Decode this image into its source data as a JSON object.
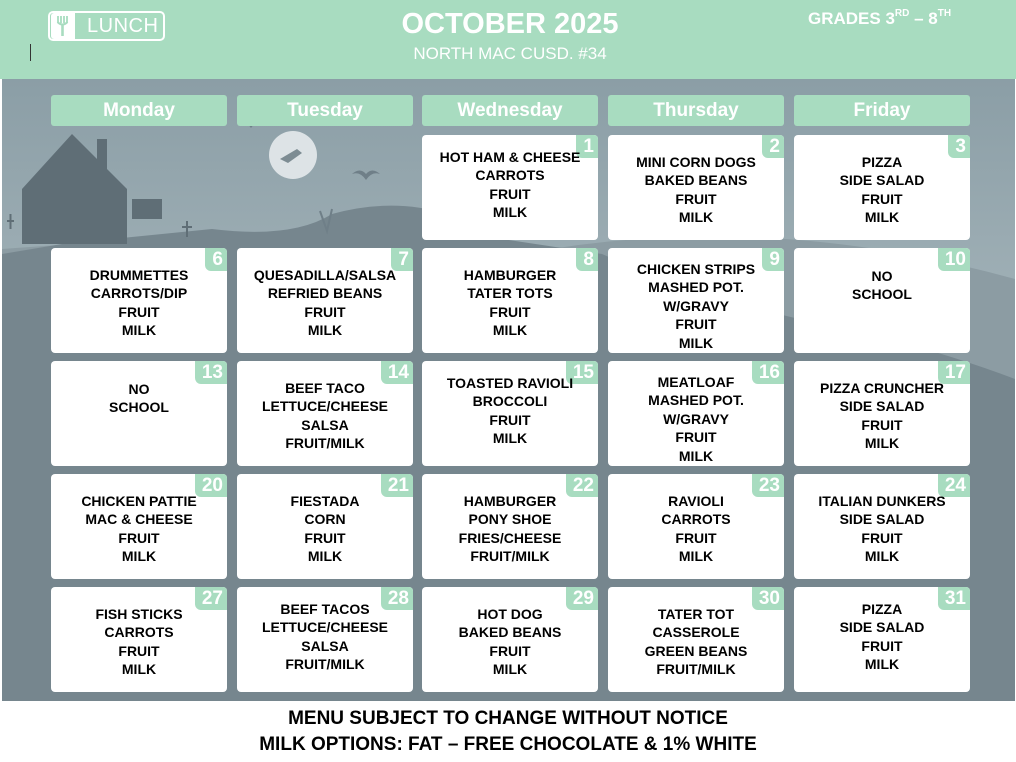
{
  "header": {
    "logo_label": "LUNCH",
    "title": "OCTOBER 2025",
    "subtitle": "NORTH MAC CUSD. #34",
    "grades": {
      "prefix": "GRADES 3",
      "sup1": "RD",
      "middle": " – 8",
      "sup2": "TH"
    }
  },
  "weekdays": [
    "Monday",
    "Tuesday",
    "Wednesday",
    "Thursday",
    "Friday"
  ],
  "weeks": [
    [
      null,
      null,
      {
        "day": "1",
        "items": [
          "HOT HAM & CHEESE",
          "CARROTS",
          "FRUIT",
          "MILK"
        ]
      },
      {
        "day": "2",
        "items": [
          "MINI CORN DOGS",
          "BAKED BEANS",
          "FRUIT",
          "MILK"
        ]
      },
      {
        "day": "3",
        "items": [
          "PIZZA",
          "SIDE SALAD",
          "FRUIT",
          "MILK"
        ]
      }
    ],
    [
      {
        "day": "6",
        "items": [
          "DRUMMETTES",
          "CARROTS/DIP",
          "FRUIT",
          "MILK"
        ]
      },
      {
        "day": "7",
        "items": [
          "QUESADILLA/SALSA",
          "REFRIED BEANS",
          "FRUIT",
          "MILK"
        ]
      },
      {
        "day": "8",
        "items": [
          "HAMBURGER",
          "TATER TOTS",
          "FRUIT",
          "MILK"
        ]
      },
      {
        "day": "9",
        "items": [
          "CHICKEN STRIPS",
          "MASHED POT.",
          "W/GRAVY",
          "FRUIT",
          "MILK"
        ]
      },
      {
        "day": "10",
        "items": [
          "NO",
          "SCHOOL"
        ]
      }
    ],
    [
      {
        "day": "13",
        "items": [
          "NO",
          "SCHOOL"
        ]
      },
      {
        "day": "14",
        "items": [
          "BEEF TACO",
          "LETTUCE/CHEESE",
          "SALSA",
          "FRUIT/MILK"
        ]
      },
      {
        "day": "15",
        "items": [
          "TOASTED RAVIOLI",
          "BROCCOLI",
          "FRUIT",
          "MILK"
        ]
      },
      {
        "day": "16",
        "items": [
          "MEATLOAF",
          "MASHED POT.",
          "W/GRAVY",
          "FRUIT",
          "MILK"
        ]
      },
      {
        "day": "17",
        "items": [
          "PIZZA CRUNCHER",
          "SIDE SALAD",
          "FRUIT",
          "MILK"
        ]
      }
    ],
    [
      {
        "day": "20",
        "items": [
          "CHICKEN PATTIE",
          "MAC & CHEESE",
          "FRUIT",
          "MILK"
        ]
      },
      {
        "day": "21",
        "items": [
          "FIESTADA",
          "CORN",
          "FRUIT",
          "MILK"
        ]
      },
      {
        "day": "22",
        "items": [
          "HAMBURGER",
          "PONY SHOE",
          "FRIES/CHEESE",
          "FRUIT/MILK"
        ]
      },
      {
        "day": "23",
        "items": [
          "RAVIOLI",
          "CARROTS",
          "FRUIT",
          "MILK"
        ]
      },
      {
        "day": "24",
        "items": [
          "ITALIAN DUNKERS",
          "SIDE SALAD",
          "FRUIT",
          "MILK"
        ]
      }
    ],
    [
      {
        "day": "27",
        "items": [
          "FISH STICKS",
          "CARROTS",
          "FRUIT",
          "MILK"
        ]
      },
      {
        "day": "28",
        "items": [
          "BEEF TACOS",
          "LETTUCE/CHEESE",
          "SALSA",
          "FRUIT/MILK"
        ]
      },
      {
        "day": "29",
        "items": [
          "HOT DOG",
          "BAKED BEANS",
          "FRUIT",
          "MILK"
        ]
      },
      {
        "day": "30",
        "items": [
          "TATER TOT",
          "CASSEROLE",
          "GREEN BEANS",
          "FRUIT/MILK"
        ]
      },
      {
        "day": "31",
        "items": [
          "PIZZA",
          "SIDE SALAD",
          "FRUIT",
          "MILK"
        ]
      }
    ]
  ],
  "footer": {
    "line1": "MENU SUBJECT TO CHANGE WITHOUT NOTICE",
    "line2": "MILK OPTIONS: FAT – FREE CHOCOLATE & 1% WHITE"
  },
  "colors": {
    "accent": "#a8dcc0",
    "background": "#9aabb2",
    "silhouette": "#6f7f88"
  },
  "icons": {
    "logo": "fork-icon"
  }
}
